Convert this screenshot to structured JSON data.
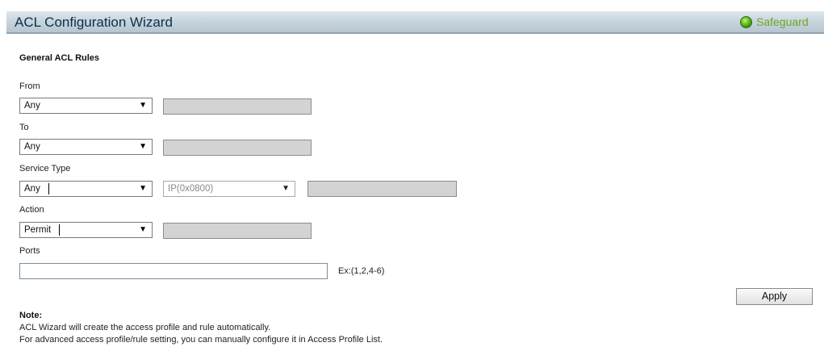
{
  "header": {
    "title": "ACL Configuration Wizard",
    "safeguard_label": "Safeguard",
    "safeguard_color": "#4caa12"
  },
  "section_title": "General ACL Rules",
  "from": {
    "label": "From",
    "selected": "Any"
  },
  "to": {
    "label": "To",
    "selected": "Any"
  },
  "service_type": {
    "label": "Service Type",
    "selected": "Any",
    "ether_type": "IP(0x0800)"
  },
  "action": {
    "label": "Action",
    "selected": "Permit"
  },
  "ports": {
    "label": "Ports",
    "value": "",
    "example": "Ex:(1,2,4-6)"
  },
  "apply_label": "Apply",
  "note": {
    "title": "Note:",
    "lines": [
      "ACL Wizard will create the access profile and rule automatically.",
      "For advanced access profile/rule setting, you can manually configure it in Access Profile List."
    ]
  },
  "icons": {
    "dropdown": "chevron-down-icon",
    "status": "green-status-dot-icon"
  }
}
